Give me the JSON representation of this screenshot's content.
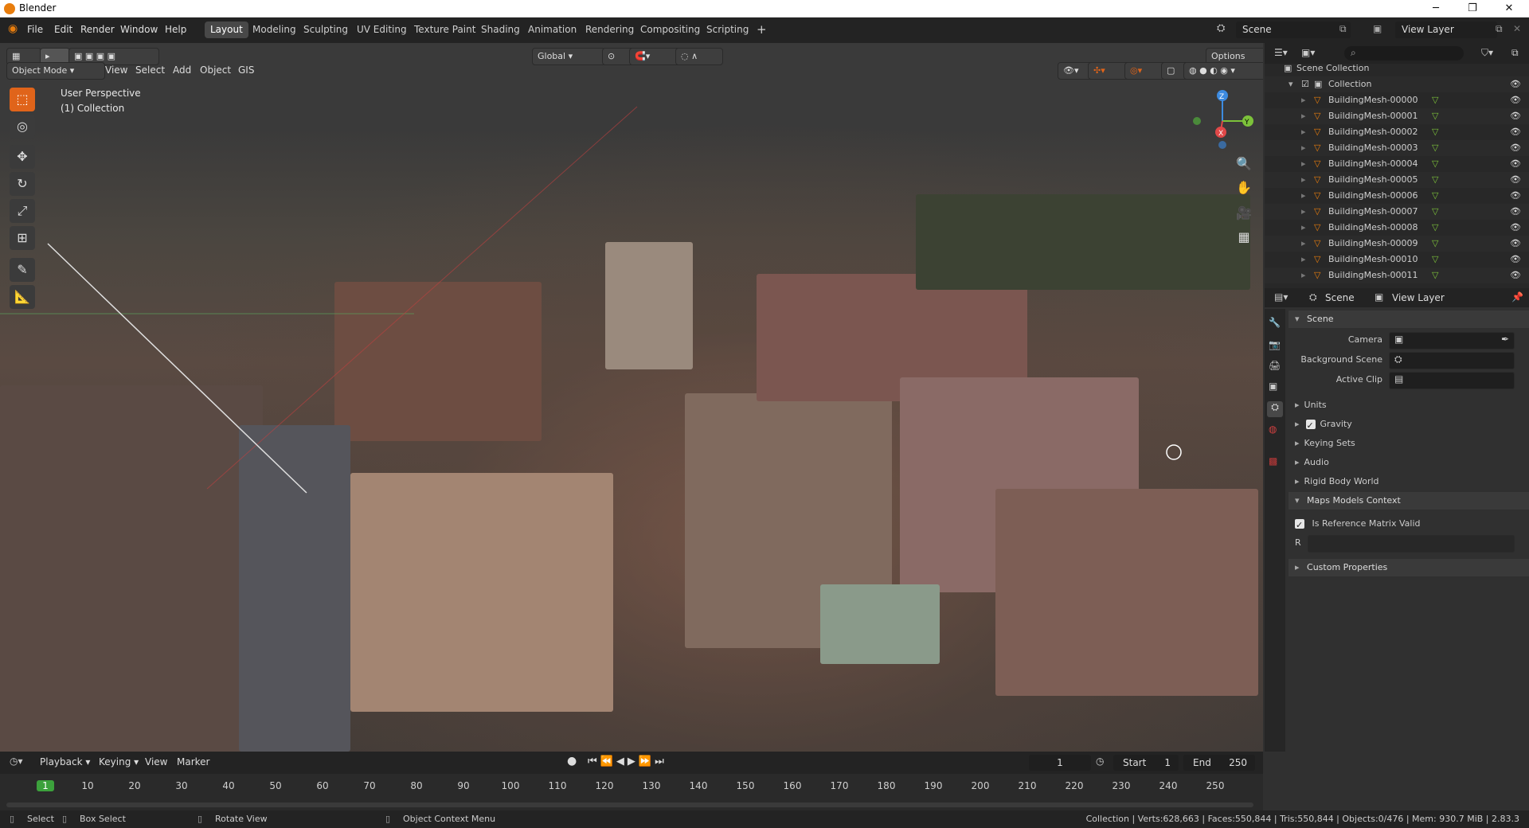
{
  "window": {
    "title": "Blender",
    "minimize": "─",
    "maximize": "❐",
    "close": "✕"
  },
  "menus": [
    "File",
    "Edit",
    "Render",
    "Window",
    "Help"
  ],
  "workspaces": [
    "Layout",
    "Modeling",
    "Sculpting",
    "UV Editing",
    "Texture Paint",
    "Shading",
    "Animation",
    "Rendering",
    "Compositing",
    "Scripting"
  ],
  "active_workspace": "Layout",
  "add_workspace": "+",
  "scene_field": "Scene",
  "view_layer_field": "View Layer",
  "viewport": {
    "mode": "Object Mode",
    "menu": [
      "View",
      "Select",
      "Add",
      "Object",
      "GIS"
    ],
    "orientation": "Global",
    "options": "Options",
    "overlay_title": "User Perspective",
    "overlay_collection": "(1) Collection",
    "gizmo": {
      "z": "Z",
      "y": "Y",
      "x": "X"
    }
  },
  "outliner": {
    "root": "Scene Collection",
    "collection": "Collection",
    "items": [
      "BuildingMesh-00000",
      "BuildingMesh-00001",
      "BuildingMesh-00002",
      "BuildingMesh-00003",
      "BuildingMesh-00004",
      "BuildingMesh-00005",
      "BuildingMesh-00006",
      "BuildingMesh-00007",
      "BuildingMesh-00008",
      "BuildingMesh-00009",
      "BuildingMesh-00010",
      "BuildingMesh-00011"
    ]
  },
  "properties": {
    "tabs": {
      "scene": "Scene",
      "view_layer": "View Layer"
    },
    "scene_panel": "Scene",
    "camera_label": "Camera",
    "background_scene_label": "Background Scene",
    "active_clip_label": "Active Clip",
    "collapsed_panels": [
      "Units",
      "Gravity",
      "Keying Sets",
      "Audio",
      "Rigid Body World"
    ],
    "maps_panel": "Maps Models Context",
    "is_reference_label": "Is Reference Matrix Valid",
    "r_label": "R",
    "custom_props": "Custom Properties"
  },
  "timeline": {
    "menus": [
      "Playback",
      "Keying",
      "View",
      "Marker"
    ],
    "current_frame": "1",
    "start_label": "Start",
    "start_value": "1",
    "end_label": "End",
    "end_value": "250",
    "ticks": [
      "1",
      "10",
      "20",
      "30",
      "40",
      "50",
      "60",
      "70",
      "80",
      "90",
      "100",
      "110",
      "120",
      "130",
      "140",
      "150",
      "160",
      "170",
      "180",
      "190",
      "200",
      "210",
      "220",
      "230",
      "240",
      "250"
    ]
  },
  "status": {
    "select": "Select",
    "box_select": "Box Select",
    "rotate_view": "Rotate View",
    "context_menu": "Object Context Menu",
    "stats": "Collection | Verts:628,663 | Faces:550,844 | Tris:550,844 | Objects:0/476 | Mem: 930.7 MiB | 2.83.3"
  },
  "colors": {
    "accent": "#e0641a",
    "active_frame": "#3ca13c",
    "header": "#232323",
    "panel": "#303030",
    "axis_x": "#e04848",
    "axis_y": "#7cc23a",
    "axis_z": "#3d8be0"
  }
}
